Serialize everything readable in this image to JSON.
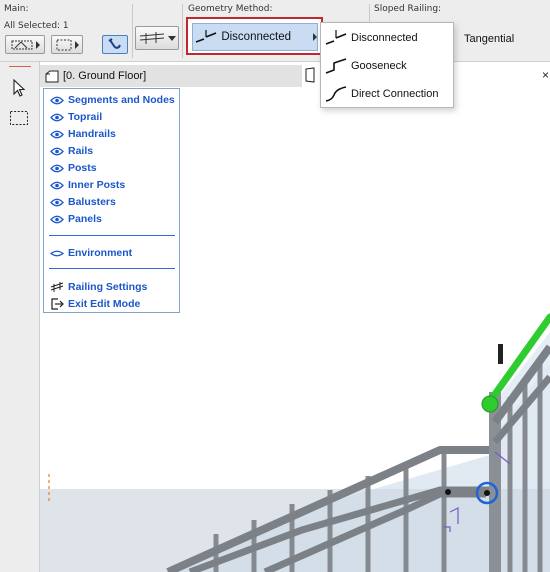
{
  "infobox": {
    "main_label": "Main:",
    "all_selected": "All Selected: 1",
    "geometry_method_label": "Geometry Method:",
    "geometry_method_value": "Disconnected",
    "sloped_railing_label": "Sloped Railing:",
    "sloped_railing_value": "Tangential"
  },
  "geometry_menu": {
    "items": [
      {
        "label": "Disconnected",
        "icon": "disconnected-icon"
      },
      {
        "label": "Gooseneck",
        "icon": "gooseneck-icon"
      },
      {
        "label": "Direct Connection",
        "icon": "direct-connection-icon"
      }
    ]
  },
  "view": {
    "tab_title": "[0. Ground Floor]",
    "close_glyph": "×"
  },
  "navigator": {
    "items": [
      {
        "label": "Segments and Nodes",
        "icon": "eye-icon"
      },
      {
        "label": "Toprail",
        "icon": "eye-icon"
      },
      {
        "label": "Handrails",
        "icon": "eye-icon"
      },
      {
        "label": "Rails",
        "icon": "eye-icon"
      },
      {
        "label": "Posts",
        "icon": "eye-icon"
      },
      {
        "label": "Inner Posts",
        "icon": "eye-icon"
      },
      {
        "label": "Balusters",
        "icon": "eye-icon"
      },
      {
        "label": "Panels",
        "icon": "eye-icon"
      }
    ],
    "environment": {
      "label": "Environment",
      "icon": "eye-closed-icon"
    },
    "railing_settings": {
      "label": "Railing Settings",
      "icon": "railing-settings-icon"
    },
    "exit_edit_mode": {
      "label": "Exit Edit Mode",
      "icon": "exit-icon"
    }
  },
  "colors": {
    "accent_blue": "#1b57c9",
    "highlight_red": "#c0282d",
    "selection_blue": "#c9dcf2",
    "toprail_green": "#2ecc2e"
  }
}
